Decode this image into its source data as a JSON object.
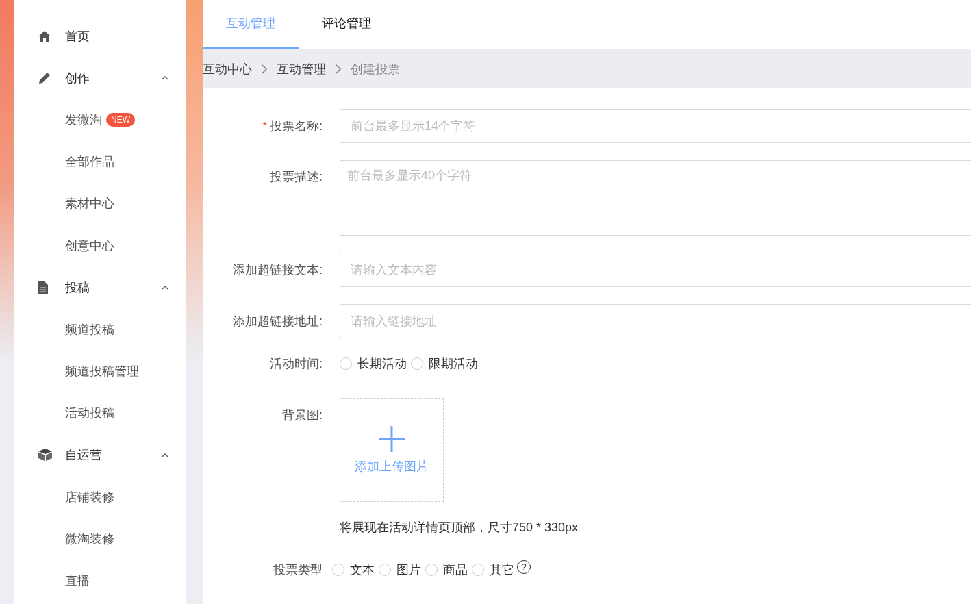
{
  "sidebar": {
    "items": [
      {
        "label": "首页"
      },
      {
        "label": "创作",
        "expanded": true,
        "children": [
          {
            "label": "发微淘",
            "badge": "NEW"
          },
          {
            "label": "全部作品"
          },
          {
            "label": "素材中心"
          },
          {
            "label": "创意中心"
          }
        ]
      },
      {
        "label": "投稿",
        "expanded": true,
        "children": [
          {
            "label": "频道投稿"
          },
          {
            "label": "频道投稿管理"
          },
          {
            "label": "活动投稿"
          }
        ]
      },
      {
        "label": "自运营",
        "expanded": true,
        "children": [
          {
            "label": "店铺装修"
          },
          {
            "label": "微淘装修"
          },
          {
            "label": "直播"
          }
        ]
      }
    ]
  },
  "tabs": [
    {
      "label": "互动管理",
      "selected": true
    },
    {
      "label": "评论管理",
      "selected": false
    }
  ],
  "breadcrumb": [
    "互动中心",
    "互动管理",
    "创建投票"
  ],
  "form": {
    "fields": [
      {
        "kind": "input",
        "required_mark": "*",
        "label": "投票名称:",
        "placeholder": "前台最多显示14个字符"
      },
      {
        "kind": "textarea",
        "label": "投票描述:",
        "placeholder": "前台最多显示40个字符"
      },
      {
        "kind": "input",
        "label": "添加超链接文本:",
        "placeholder": "请输入文本内容"
      },
      {
        "kind": "input",
        "label": "添加超链接地址:",
        "placeholder": "请输入链接地址"
      },
      {
        "kind": "radio",
        "label": "活动时间:",
        "options": [
          {
            "label": "长期活动",
            "selected": false
          },
          {
            "label": "限期活动",
            "selected": false
          }
        ]
      },
      {
        "kind": "upload",
        "label": "背景图:",
        "button": "添加上传图片",
        "hint": "将展现在活动详情页顶部，尺寸750 * 330px"
      },
      {
        "kind": "radio",
        "label": "投票类型",
        "help": "?",
        "options": [
          {
            "label": "文本",
            "selected": false
          },
          {
            "label": "图片",
            "selected": false
          },
          {
            "label": "商品",
            "selected": false
          },
          {
            "label": "其它",
            "selected": false
          }
        ]
      }
    ]
  }
}
